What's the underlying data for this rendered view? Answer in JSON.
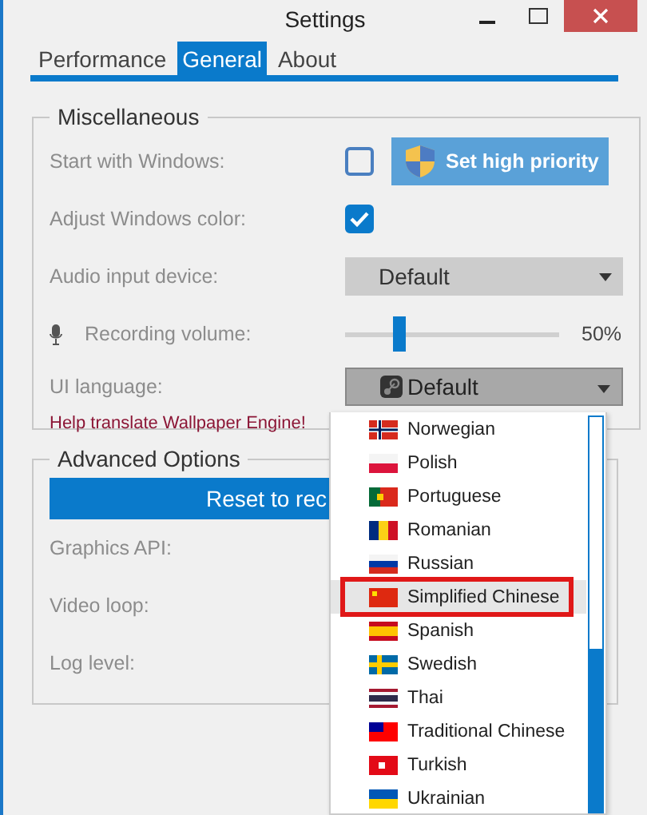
{
  "window": {
    "title": "Settings"
  },
  "tabs": [
    {
      "label": "Performance",
      "selected": false
    },
    {
      "label": "General",
      "selected": true
    },
    {
      "label": "About",
      "selected": false
    }
  ],
  "miscellaneous": {
    "title": "Miscellaneous",
    "start_with_windows": {
      "label": "Start with Windows:",
      "checked": false
    },
    "high_priority_button": "Set high priority",
    "adjust_windows_color": {
      "label": "Adjust Windows color:",
      "checked": true
    },
    "audio_input_device": {
      "label": "Audio input device:",
      "value": "Default"
    },
    "recording_volume": {
      "label": "Recording volume:",
      "level": 0.25,
      "reading": "50%"
    },
    "ui_language": {
      "label": "UI language:",
      "value": "Default"
    },
    "help_link": "Help translate Wallpaper Engine!"
  },
  "advanced_options": {
    "title": "Advanced Options",
    "reset_button": "Reset to rec",
    "rows": [
      "Graphics API:",
      "Video loop:",
      "Log level:"
    ]
  },
  "language_list": [
    {
      "label": "Norwegian",
      "selected": false,
      "highlighted": false
    },
    {
      "label": "Polish",
      "selected": false,
      "highlighted": false
    },
    {
      "label": "Portuguese",
      "selected": false,
      "highlighted": false
    },
    {
      "label": "Romanian",
      "selected": false,
      "highlighted": false
    },
    {
      "label": "Russian",
      "selected": false,
      "highlighted": false
    },
    {
      "label": "Simplified Chinese",
      "selected": true,
      "highlighted": true
    },
    {
      "label": "Spanish",
      "selected": false,
      "highlighted": false
    },
    {
      "label": "Swedish",
      "selected": false,
      "highlighted": false
    },
    {
      "label": "Thai",
      "selected": false,
      "highlighted": false
    },
    {
      "label": "Traditional Chinese",
      "selected": false,
      "highlighted": false
    },
    {
      "label": "Turkish",
      "selected": false,
      "highlighted": false
    },
    {
      "label": "Ukrainian",
      "selected": false,
      "highlighted": false
    }
  ]
}
